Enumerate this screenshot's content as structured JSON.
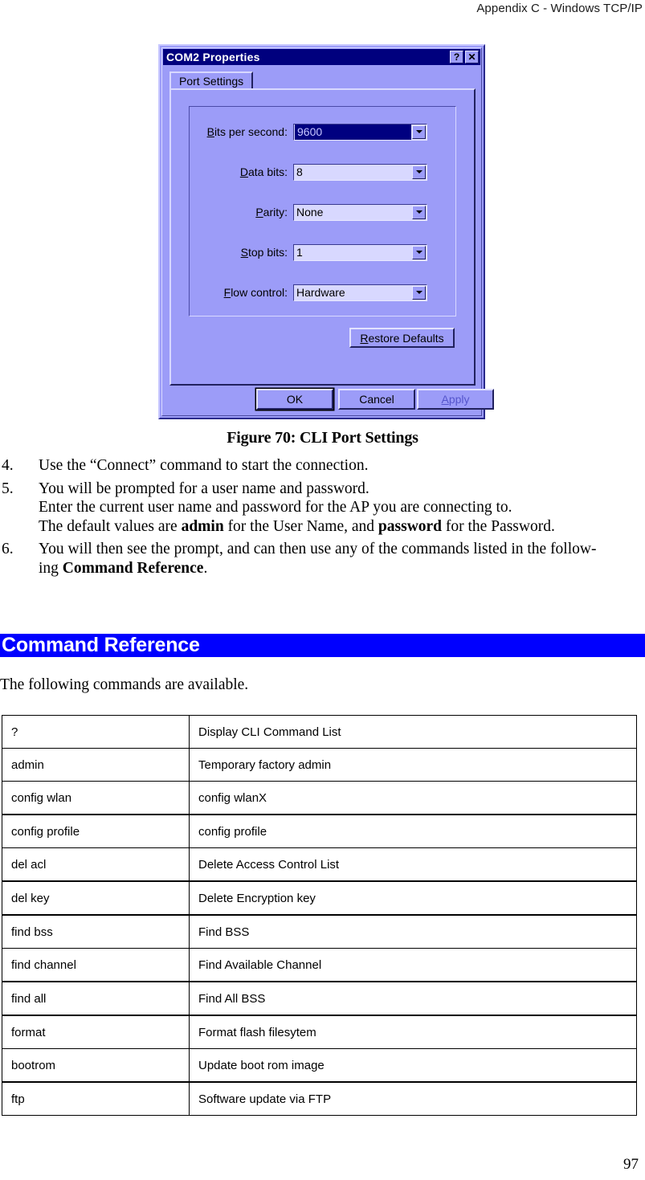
{
  "header": {
    "running_head": "Appendix C - Windows TCP/IP"
  },
  "dialog": {
    "title": "COM2 Properties",
    "help_button": "?",
    "close_button": "✕",
    "tab_label": "Port Settings",
    "fields": [
      {
        "label_pre": "",
        "label_accel": "B",
        "label_post": "its per second:",
        "value": "9600",
        "selected": true
      },
      {
        "label_pre": "",
        "label_accel": "D",
        "label_post": "ata bits:",
        "value": "8",
        "selected": false
      },
      {
        "label_pre": "",
        "label_accel": "P",
        "label_post": "arity:",
        "value": "None",
        "selected": false
      },
      {
        "label_pre": "",
        "label_accel": "S",
        "label_post": "top bits:",
        "value": "1",
        "selected": false
      },
      {
        "label_pre": "",
        "label_accel": "F",
        "label_post": "low control:",
        "value": "Hardware",
        "selected": false
      }
    ],
    "restore_defaults": {
      "accel": "R",
      "rest": "estore Defaults"
    },
    "ok_label": "OK",
    "cancel_label": "Cancel",
    "apply": {
      "accel": "A",
      "rest": "pply"
    }
  },
  "figure": {
    "caption": "Figure 70: CLI Port Settings"
  },
  "steps": [
    {
      "number": "4.",
      "lines": [
        {
          "text": "Use the “Connect” command to start the connection."
        }
      ]
    },
    {
      "number": "5.",
      "lines": [
        {
          "text": "You will be prompted for a user name and password."
        },
        {
          "text": "Enter the current user name and password for the AP you are connecting to."
        },
        {
          "pre": "The default values are ",
          "bold1": "admin",
          "mid": " for the User Name, and ",
          "bold2": "password",
          "post": " for the Password."
        }
      ]
    },
    {
      "number": "6.",
      "lines": [
        {
          "text": "You will then see the prompt, and can then use any of the commands listed in the follow-"
        },
        {
          "pre": "ing ",
          "bold1": "Command Reference",
          "post": "."
        }
      ]
    }
  ],
  "section": {
    "heading": "Command Reference",
    "intro": "The following commands are available."
  },
  "command_table": {
    "rows": [
      {
        "command": "?",
        "description": "Display CLI Command List"
      },
      {
        "command": "admin",
        "description": "Temporary factory admin"
      },
      {
        "command": "config wlan",
        "description": "config wlanX"
      },
      {
        "command": "config profile",
        "description": "config profile"
      },
      {
        "command": "del acl",
        "description": "Delete Access Control List"
      },
      {
        "command": "del key",
        "description": "Delete Encryption key"
      },
      {
        "command": "find bss",
        "description": "Find BSS"
      },
      {
        "command": "find channel",
        "description": "Find Available Channel"
      },
      {
        "command": "find all",
        "description": "Find All BSS"
      },
      {
        "command": "format",
        "description": "Format flash filesytem"
      },
      {
        "command": "bootrom",
        "description": "Update boot rom image"
      },
      {
        "command": "ftp",
        "description": "Software update via FTP"
      }
    ]
  },
  "footer": {
    "page_number": "97"
  },
  "colors": {
    "heading_band": "#0000ff",
    "dialog_face": "#9c9cf8",
    "titlebar": "#00007e",
    "selection": "#000080"
  }
}
